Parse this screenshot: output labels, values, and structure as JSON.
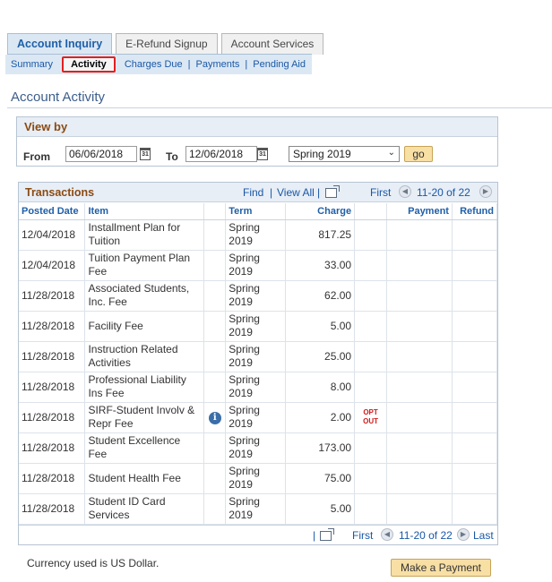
{
  "tabs": [
    {
      "label": "Account Inquiry",
      "active": true
    },
    {
      "label": "E-Refund Signup",
      "active": false
    },
    {
      "label": "Account Services",
      "active": false
    }
  ],
  "subnav": {
    "summary": "Summary",
    "activity": "Activity",
    "charges_due": "Charges Due",
    "payments": "Payments",
    "pending_aid": "Pending Aid",
    "separator": "|"
  },
  "page_title": "Account Activity",
  "view_by": {
    "title": "View by",
    "from_label": "From",
    "from_value": "06/06/2018",
    "to_label": "To",
    "to_value": "12/06/2018",
    "term_selected": "Spring 2019",
    "go_label": "go"
  },
  "grid": {
    "title": "Transactions",
    "find": "Find",
    "view_all": "View All",
    "nav_sep": "|",
    "first": "First",
    "last": "Last",
    "range": "11-20 of 22",
    "columns": {
      "posted_date": "Posted Date",
      "item": "Item",
      "term": "Term",
      "charge": "Charge",
      "payment": "Payment",
      "refund": "Refund"
    },
    "rows": [
      {
        "date": "12/04/2018",
        "item": "Installment Plan for Tuition",
        "term": "Spring 2019",
        "charge": "817.25",
        "payment": "",
        "refund": "",
        "info": false,
        "opt_out": ""
      },
      {
        "date": "12/04/2018",
        "item": "Tuition Payment Plan Fee",
        "term": "Spring 2019",
        "charge": "33.00",
        "payment": "",
        "refund": "",
        "info": false,
        "opt_out": ""
      },
      {
        "date": "11/28/2018",
        "item": "Associated Students, Inc. Fee",
        "term": "Spring 2019",
        "charge": "62.00",
        "payment": "",
        "refund": "",
        "info": false,
        "opt_out": ""
      },
      {
        "date": "11/28/2018",
        "item": "Facility Fee",
        "term": "Spring 2019",
        "charge": "5.00",
        "payment": "",
        "refund": "",
        "info": false,
        "opt_out": ""
      },
      {
        "date": "11/28/2018",
        "item": "Instruction Related Activities",
        "term": "Spring 2019",
        "charge": "25.00",
        "payment": "",
        "refund": "",
        "info": false,
        "opt_out": ""
      },
      {
        "date": "11/28/2018",
        "item": "Professional Liability Ins Fee",
        "term": "Spring 2019",
        "charge": "8.00",
        "payment": "",
        "refund": "",
        "info": false,
        "opt_out": ""
      },
      {
        "date": "11/28/2018",
        "item": "SIRF-Student Involv & Repr Fee",
        "term": "Spring 2019",
        "charge": "2.00",
        "payment": "",
        "refund": "",
        "info": true,
        "opt_out": "OPT OUT"
      },
      {
        "date": "11/28/2018",
        "item": "Student Excellence Fee",
        "term": "Spring 2019",
        "charge": "173.00",
        "payment": "",
        "refund": "",
        "info": false,
        "opt_out": ""
      },
      {
        "date": "11/28/2018",
        "item": "Student Health Fee",
        "term": "Spring 2019",
        "charge": "75.00",
        "payment": "",
        "refund": "",
        "info": false,
        "opt_out": ""
      },
      {
        "date": "11/28/2018",
        "item": "Student ID Card Services",
        "term": "Spring 2019",
        "charge": "5.00",
        "payment": "",
        "refund": "",
        "info": false,
        "opt_out": ""
      }
    ]
  },
  "icons": {
    "calendar": "calendar-icon",
    "info": "info-icon",
    "zoom": "zoom-icon",
    "prev": "chevron-left-icon",
    "next": "chevron-right-icon"
  },
  "colors": {
    "accent_blue": "#1f5fa8",
    "section_brown": "#8b4a12",
    "button_gold": "#f8dfa4",
    "opt_out_red": "#d11a1a",
    "active_highlight": "#e02020"
  },
  "footer": {
    "currency": "Currency used is US Dollar.",
    "make_payment": "Make a Payment"
  }
}
